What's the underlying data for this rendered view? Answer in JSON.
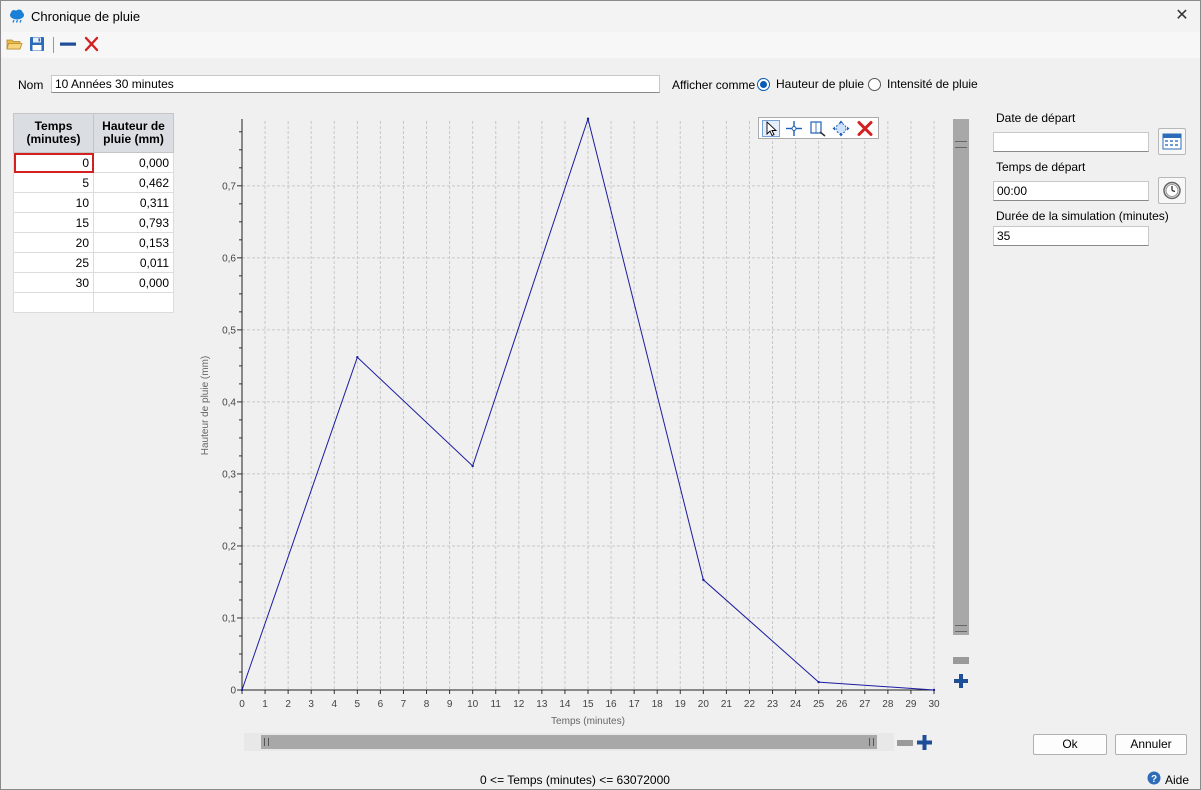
{
  "window": {
    "title": "Chronique de pluie",
    "close_symbol": "✕"
  },
  "toolbar": {
    "open_icon": "folder-open-icon",
    "save_icon": "save-icon",
    "remove_icon": "minus-icon",
    "delete_icon": "delete-x-icon"
  },
  "form": {
    "name_label": "Nom",
    "name_value": "10 Années 30 minutes",
    "display_as_label": "Afficher comme",
    "radio_height_label": "Hauteur de pluie",
    "radio_intensity_label": "Intensité de pluie",
    "selected_mode": "Hauteur de pluie"
  },
  "table": {
    "headers": [
      "Temps\n(minutes)",
      "Hauteur de\npluie (mm)"
    ],
    "header_time_line1": "Temps",
    "header_time_line2": "(minutes)",
    "header_height_line1": "Hauteur de",
    "header_height_line2": "pluie (mm)",
    "rows": [
      [
        "0",
        "0,000"
      ],
      [
        "5",
        "0,462"
      ],
      [
        "10",
        "0,311"
      ],
      [
        "15",
        "0,793"
      ],
      [
        "20",
        "0,153"
      ],
      [
        "25",
        "0,011"
      ],
      [
        "30",
        "0,000"
      ]
    ]
  },
  "chart_data": {
    "type": "line",
    "x": [
      0,
      5,
      10,
      15,
      20,
      25,
      30
    ],
    "series": [
      {
        "values": [
          0,
          0.462,
          0.311,
          0.793,
          0.153,
          0.011,
          0
        ],
        "color": "#1c1ca0"
      }
    ],
    "xlabel": "Temps (minutes)",
    "ylabel": "Hauteur de pluie (mm)",
    "xlim": [
      0,
      30
    ],
    "ylim": [
      0,
      0.79
    ],
    "xticks": [
      "0",
      "1",
      "2",
      "3",
      "4",
      "5",
      "6",
      "7",
      "8",
      "9",
      "10",
      "11",
      "12",
      "13",
      "14",
      "15",
      "16",
      "17",
      "18",
      "19",
      "20",
      "21",
      "22",
      "23",
      "24",
      "25",
      "26",
      "27",
      "28",
      "29",
      "30"
    ],
    "yticks": [
      "0",
      "0,1",
      "0,2",
      "0,3",
      "0,4",
      "0,5",
      "0,6",
      "0,7"
    ],
    "ytick_values": [
      0,
      0.1,
      0.2,
      0.3,
      0.4,
      0.5,
      0.6,
      0.7
    ],
    "grid": true,
    "legend": "none"
  },
  "chart_tools": [
    "pointer-icon",
    "crosshair-icon",
    "zoom-box-icon",
    "pan-icon",
    "close-chart-icon"
  ],
  "side": {
    "start_date_label": "Date de départ",
    "start_date_value": "",
    "start_time_label": "Temps de départ",
    "start_time_value": "00:00",
    "duration_label": "Durée de la simulation (minutes)",
    "duration_value": "35"
  },
  "buttons": {
    "ok": "Ok",
    "cancel": "Annuler",
    "help": "Aide"
  },
  "status": {
    "range_text": "0 <= Temps (minutes) <= 63072000"
  },
  "colors": {
    "accent": "#0a5ab4",
    "line": "#1c1ca0",
    "selected_cell": "#d32020",
    "delete": "#d32020"
  }
}
